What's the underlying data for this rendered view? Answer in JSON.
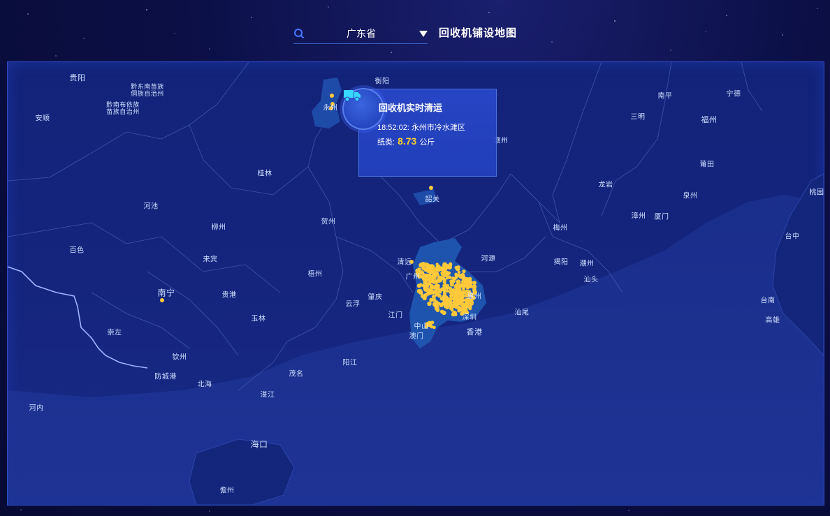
{
  "header": {
    "search_icon": "search-icon",
    "province": "广东省",
    "dropdown_icon": "chevron-down-icon",
    "title": "回收机铺设地图"
  },
  "tooltip": {
    "icon": "truck-icon",
    "title": "回收机实时清运",
    "time": "18:52:02:",
    "location": "永州市冷水滩区",
    "category_label": "纸类:",
    "value": "8.73",
    "unit": "公斤"
  },
  "map": {
    "cities": [
      {
        "id": "guiyang",
        "name": "贵阳"
      },
      {
        "id": "qiandongnan",
        "name": "黔东南苗族侗族自治州"
      },
      {
        "id": "qiannan",
        "name": "黔南布依族苗族自治州"
      },
      {
        "id": "anshun",
        "name": "安顺"
      },
      {
        "id": "hengyang",
        "name": "衡阳"
      },
      {
        "id": "yongzhou",
        "name": "永州"
      },
      {
        "id": "ganzhou",
        "name": "赣州"
      },
      {
        "id": "guilin",
        "name": "桂林"
      },
      {
        "id": "hechi",
        "name": "河池"
      },
      {
        "id": "liuzhou",
        "name": "柳州"
      },
      {
        "id": "hezhou",
        "name": "贺州"
      },
      {
        "id": "baise",
        "name": "百色"
      },
      {
        "id": "laibin",
        "name": "来宾"
      },
      {
        "id": "wuzhou",
        "name": "梧州"
      },
      {
        "id": "nanning",
        "name": "南宁"
      },
      {
        "id": "guigang",
        "name": "贵港"
      },
      {
        "id": "yulin",
        "name": "玉林"
      },
      {
        "id": "chongzuo",
        "name": "崇左"
      },
      {
        "id": "qinzhou",
        "name": "钦州"
      },
      {
        "id": "fangchenggang",
        "name": "防城港"
      },
      {
        "id": "beihai",
        "name": "北海"
      },
      {
        "id": "hanoi",
        "name": "河内"
      },
      {
        "id": "shaoguan",
        "name": "韶关"
      },
      {
        "id": "qingyuan",
        "name": "清远"
      },
      {
        "id": "guangzhou",
        "name": "广州"
      },
      {
        "id": "heyuan",
        "name": "河源"
      },
      {
        "id": "huizhou",
        "name": "惠州"
      },
      {
        "id": "zhaoqing",
        "name": "肇庆"
      },
      {
        "id": "yunfu",
        "name": "云浮"
      },
      {
        "id": "jiangmen",
        "name": "江门"
      },
      {
        "id": "shenzhen",
        "name": "深圳"
      },
      {
        "id": "zhongshan",
        "name": "中山"
      },
      {
        "id": "macau",
        "name": "澳门"
      },
      {
        "id": "hongkong",
        "name": "香港"
      },
      {
        "id": "shanwei",
        "name": "汕尾"
      },
      {
        "id": "maoming",
        "name": "茂名"
      },
      {
        "id": "yangjiang",
        "name": "阳江"
      },
      {
        "id": "zhanjiang",
        "name": "湛江"
      },
      {
        "id": "haikou",
        "name": "海口"
      },
      {
        "id": "danzhou",
        "name": "儋州"
      },
      {
        "id": "meizhou",
        "name": "梅州"
      },
      {
        "id": "jieyang",
        "name": "揭阳"
      },
      {
        "id": "chaozhou",
        "name": "潮州"
      },
      {
        "id": "shantou",
        "name": "汕头"
      },
      {
        "id": "longyan",
        "name": "龙岩"
      },
      {
        "id": "zhangzhou",
        "name": "漳州"
      },
      {
        "id": "xiamen",
        "name": "厦门"
      },
      {
        "id": "quanzhou",
        "name": "泉州"
      },
      {
        "id": "putian",
        "name": "莆田"
      },
      {
        "id": "fuzhou",
        "name": "福州"
      },
      {
        "id": "sanming",
        "name": "三明"
      },
      {
        "id": "nanping",
        "name": "南平"
      },
      {
        "id": "ningde",
        "name": "宁德"
      },
      {
        "id": "taizhong",
        "name": "台中"
      },
      {
        "id": "tainan",
        "name": "台南"
      },
      {
        "id": "gaoxiong",
        "name": "高雄"
      },
      {
        "id": "taoyuan",
        "name": "桃园"
      }
    ]
  },
  "colors": {
    "marker": "#ffc93a",
    "accent": "#4a78ff"
  }
}
